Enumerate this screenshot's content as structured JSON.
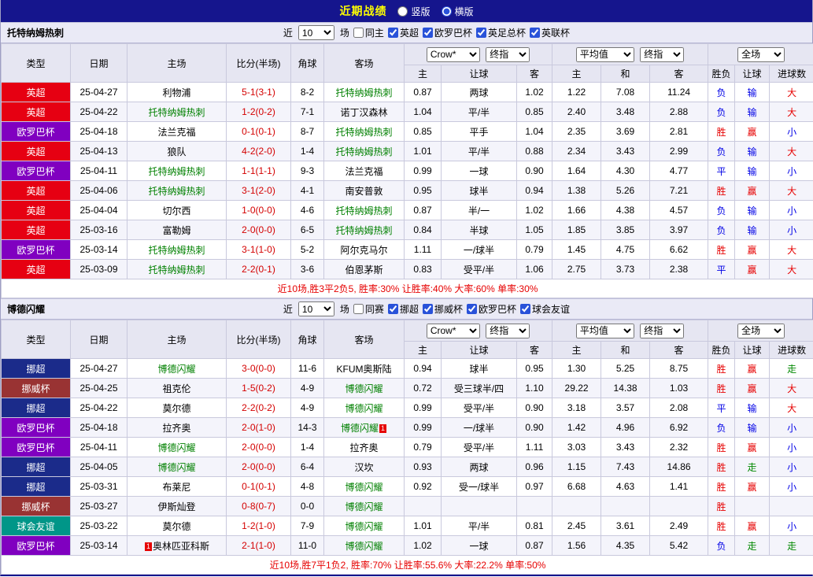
{
  "topbar": {
    "title": "近期战绩",
    "vertical_label": "竖版",
    "horizontal_label": "横版"
  },
  "filter_labels": {
    "near": "近",
    "matches": "场"
  },
  "dropdowns": {
    "near_count": "10",
    "bookmaker": "Crow*",
    "final_odds": "终指",
    "average": "平均值",
    "final_odds2": "终指",
    "full_match": "全场"
  },
  "columns": {
    "type": "类型",
    "date": "日期",
    "home": "主场",
    "score": "比分(半场)",
    "corner": "角球",
    "away": "客场",
    "sub": [
      "主",
      "让球",
      "客",
      "主",
      "和",
      "客",
      "胜负",
      "让球",
      "进球数"
    ]
  },
  "league_colors": {
    "英超": "#e60012",
    "欧罗巴杯": "#8000c0",
    "挪超": "#1b2b8a",
    "挪威杯": "#993333",
    "球会友谊": "#009688"
  },
  "result_colors": {
    "胜": "#e60000",
    "平": "#0000e6",
    "负": "#0000e6",
    "赢": "#e60000",
    "输": "#0000e6",
    "走": "#008800",
    "大": "#e60000",
    "小": "#0000e6"
  },
  "sections": [
    {
      "team": "托特纳姆热刺",
      "same_label": "同主",
      "leagues": [
        "英超",
        "欧罗巴杯",
        "英足总杯",
        "英联杯"
      ],
      "rows": [
        {
          "league": "英超",
          "date": "25-04-27",
          "home": "利物浦",
          "home_focal": false,
          "home_red": "",
          "score": "5-1(3-1)",
          "corners": "8-2",
          "away": "托特纳姆热刺",
          "away_focal": true,
          "away_red": "",
          "home_odds": "0.87",
          "handicap": "两球",
          "away_odds": "1.02",
          "avg_home": "1.22",
          "avg_draw": "7.08",
          "avg_away": "11.24",
          "result": "负",
          "handicap_result": "输",
          "goals_result": "大"
        },
        {
          "league": "英超",
          "date": "25-04-22",
          "home": "托特纳姆热刺",
          "home_focal": true,
          "home_red": "",
          "score": "1-2(0-2)",
          "corners": "7-1",
          "away": "诺丁汉森林",
          "away_focal": false,
          "away_red": "",
          "home_odds": "1.04",
          "handicap": "平/半",
          "away_odds": "0.85",
          "avg_home": "2.40",
          "avg_draw": "3.48",
          "avg_away": "2.88",
          "result": "负",
          "handicap_result": "输",
          "goals_result": "大"
        },
        {
          "league": "欧罗巴杯",
          "date": "25-04-18",
          "home": "法兰克福",
          "home_focal": false,
          "home_red": "",
          "score": "0-1(0-1)",
          "corners": "8-7",
          "away": "托特纳姆热刺",
          "away_focal": true,
          "away_red": "",
          "home_odds": "0.85",
          "handicap": "平手",
          "away_odds": "1.04",
          "avg_home": "2.35",
          "avg_draw": "3.69",
          "avg_away": "2.81",
          "result": "胜",
          "handicap_result": "赢",
          "goals_result": "小"
        },
        {
          "league": "英超",
          "date": "25-04-13",
          "home": "狼队",
          "home_focal": false,
          "home_red": "",
          "score": "4-2(2-0)",
          "corners": "1-4",
          "away": "托特纳姆热刺",
          "away_focal": true,
          "away_red": "",
          "home_odds": "1.01",
          "handicap": "平/半",
          "away_odds": "0.88",
          "avg_home": "2.34",
          "avg_draw": "3.43",
          "avg_away": "2.99",
          "result": "负",
          "handicap_result": "输",
          "goals_result": "大"
        },
        {
          "league": "欧罗巴杯",
          "date": "25-04-11",
          "home": "托特纳姆热刺",
          "home_focal": true,
          "home_red": "",
          "score": "1-1(1-1)",
          "corners": "9-3",
          "away": "法兰克福",
          "away_focal": false,
          "away_red": "",
          "home_odds": "0.99",
          "handicap": "一球",
          "away_odds": "0.90",
          "avg_home": "1.64",
          "avg_draw": "4.30",
          "avg_away": "4.77",
          "result": "平",
          "handicap_result": "输",
          "goals_result": "小"
        },
        {
          "league": "英超",
          "date": "25-04-06",
          "home": "托特纳姆热刺",
          "home_focal": true,
          "home_red": "",
          "score": "3-1(2-0)",
          "corners": "4-1",
          "away": "南安普敦",
          "away_focal": false,
          "away_red": "",
          "home_odds": "0.95",
          "handicap": "球半",
          "away_odds": "0.94",
          "avg_home": "1.38",
          "avg_draw": "5.26",
          "avg_away": "7.21",
          "result": "胜",
          "handicap_result": "赢",
          "goals_result": "大"
        },
        {
          "league": "英超",
          "date": "25-04-04",
          "home": "切尔西",
          "home_focal": false,
          "home_red": "",
          "score": "1-0(0-0)",
          "corners": "4-6",
          "away": "托特纳姆热刺",
          "away_focal": true,
          "away_red": "",
          "home_odds": "0.87",
          "handicap": "半/一",
          "away_odds": "1.02",
          "avg_home": "1.66",
          "avg_draw": "4.38",
          "avg_away": "4.57",
          "result": "负",
          "handicap_result": "输",
          "goals_result": "小"
        },
        {
          "league": "英超",
          "date": "25-03-16",
          "home": "富勒姆",
          "home_focal": false,
          "home_red": "",
          "score": "2-0(0-0)",
          "corners": "6-5",
          "away": "托特纳姆热刺",
          "away_focal": true,
          "away_red": "",
          "home_odds": "0.84",
          "handicap": "半球",
          "away_odds": "1.05",
          "avg_home": "1.85",
          "avg_draw": "3.85",
          "avg_away": "3.97",
          "result": "负",
          "handicap_result": "输",
          "goals_result": "小"
        },
        {
          "league": "欧罗巴杯",
          "date": "25-03-14",
          "home": "托特纳姆热刺",
          "home_focal": true,
          "home_red": "",
          "score": "3-1(1-0)",
          "corners": "5-2",
          "away": "阿尔克马尔",
          "away_focal": false,
          "away_red": "",
          "home_odds": "1.11",
          "handicap": "一/球半",
          "away_odds": "0.79",
          "avg_home": "1.45",
          "avg_draw": "4.75",
          "avg_away": "6.62",
          "result": "胜",
          "handicap_result": "赢",
          "goals_result": "大"
        },
        {
          "league": "英超",
          "date": "25-03-09",
          "home": "托特纳姆热刺",
          "home_focal": true,
          "home_red": "",
          "score": "2-2(0-1)",
          "corners": "3-6",
          "away": "伯恩茅斯",
          "away_focal": false,
          "away_red": "",
          "home_odds": "0.83",
          "handicap": "受平/半",
          "away_odds": "1.06",
          "avg_home": "2.75",
          "avg_draw": "3.73",
          "avg_away": "2.38",
          "result": "平",
          "handicap_result": "赢",
          "goals_result": "大"
        }
      ],
      "summary": "近10场,胜3平2负5, 胜率:30% 让胜率:40% 大率:60% 单率:30%"
    },
    {
      "team": "博德闪耀",
      "same_label": "同赛",
      "leagues": [
        "挪超",
        "挪威杯",
        "欧罗巴杯",
        "球会友谊"
      ],
      "rows": [
        {
          "league": "挪超",
          "date": "25-04-27",
          "home": "博德闪耀",
          "home_focal": true,
          "home_red": "",
          "score": "3-0(0-0)",
          "corners": "11-6",
          "away": "KFUM奥斯陆",
          "away_focal": false,
          "away_red": "",
          "home_odds": "0.94",
          "handicap": "球半",
          "away_odds": "0.95",
          "avg_home": "1.30",
          "avg_draw": "5.25",
          "avg_away": "8.75",
          "result": "胜",
          "handicap_result": "赢",
          "goals_result": "走"
        },
        {
          "league": "挪威杯",
          "date": "25-04-25",
          "home": "祖克伦",
          "home_focal": false,
          "home_red": "",
          "score": "1-5(0-2)",
          "corners": "4-9",
          "away": "博德闪耀",
          "away_focal": true,
          "away_red": "",
          "home_odds": "0.72",
          "handicap": "受三球半/四",
          "away_odds": "1.10",
          "avg_home": "29.22",
          "avg_draw": "14.38",
          "avg_away": "1.03",
          "result": "胜",
          "handicap_result": "赢",
          "goals_result": "大"
        },
        {
          "league": "挪超",
          "date": "25-04-22",
          "home": "莫尔德",
          "home_focal": false,
          "home_red": "",
          "score": "2-2(0-2)",
          "corners": "4-9",
          "away": "博德闪耀",
          "away_focal": true,
          "away_red": "",
          "home_odds": "0.99",
          "handicap": "受平/半",
          "away_odds": "0.90",
          "avg_home": "3.18",
          "avg_draw": "3.57",
          "avg_away": "2.08",
          "result": "平",
          "handicap_result": "输",
          "goals_result": "大"
        },
        {
          "league": "欧罗巴杯",
          "date": "25-04-18",
          "home": "拉齐奥",
          "home_focal": false,
          "home_red": "",
          "score": "2-0(1-0)",
          "corners": "14-3",
          "away": "博德闪耀",
          "away_focal": true,
          "away_red": "1",
          "home_odds": "0.99",
          "handicap": "一/球半",
          "away_odds": "0.90",
          "avg_home": "1.42",
          "avg_draw": "4.96",
          "avg_away": "6.92",
          "result": "负",
          "handicap_result": "输",
          "goals_result": "小"
        },
        {
          "league": "欧罗巴杯",
          "date": "25-04-11",
          "home": "博德闪耀",
          "home_focal": true,
          "home_red": "",
          "score": "2-0(0-0)",
          "corners": "1-4",
          "away": "拉齐奥",
          "away_focal": false,
          "away_red": "",
          "home_odds": "0.79",
          "handicap": "受平/半",
          "away_odds": "1.11",
          "avg_home": "3.03",
          "avg_draw": "3.43",
          "avg_away": "2.32",
          "result": "胜",
          "handicap_result": "赢",
          "goals_result": "小"
        },
        {
          "league": "挪超",
          "date": "25-04-05",
          "home": "博德闪耀",
          "home_focal": true,
          "home_red": "",
          "score": "2-0(0-0)",
          "corners": "6-4",
          "away": "汉坎",
          "away_focal": false,
          "away_red": "",
          "home_odds": "0.93",
          "handicap": "两球",
          "away_odds": "0.96",
          "avg_home": "1.15",
          "avg_draw": "7.43",
          "avg_away": "14.86",
          "result": "胜",
          "handicap_result": "走",
          "goals_result": "小"
        },
        {
          "league": "挪超",
          "date": "25-03-31",
          "home": "布莱尼",
          "home_focal": false,
          "home_red": "",
          "score": "0-1(0-1)",
          "corners": "4-8",
          "away": "博德闪耀",
          "away_focal": true,
          "away_red": "",
          "home_odds": "0.92",
          "handicap": "受一/球半",
          "away_odds": "0.97",
          "avg_home": "6.68",
          "avg_draw": "4.63",
          "avg_away": "1.41",
          "result": "胜",
          "handicap_result": "赢",
          "goals_result": "小"
        },
        {
          "league": "挪威杯",
          "date": "25-03-27",
          "home": "伊斯灿登",
          "home_focal": false,
          "home_red": "",
          "score": "0-8(0-7)",
          "corners": "0-0",
          "away": "博德闪耀",
          "away_focal": true,
          "away_red": "",
          "home_odds": "",
          "handicap": "",
          "away_odds": "",
          "avg_home": "",
          "avg_draw": "",
          "avg_away": "",
          "result": "胜",
          "handicap_result": "",
          "goals_result": ""
        },
        {
          "league": "球会友谊",
          "date": "25-03-22",
          "home": "莫尔德",
          "home_focal": false,
          "home_red": "",
          "score": "1-2(1-0)",
          "corners": "7-9",
          "away": "博德闪耀",
          "away_focal": true,
          "away_red": "",
          "home_odds": "1.01",
          "handicap": "平/半",
          "away_odds": "0.81",
          "avg_home": "2.45",
          "avg_draw": "3.61",
          "avg_away": "2.49",
          "result": "胜",
          "handicap_result": "赢",
          "goals_result": "小"
        },
        {
          "league": "欧罗巴杯",
          "date": "25-03-14",
          "home": "奥林匹亚科斯",
          "home_focal": false,
          "home_red": "1",
          "score": "2-1(1-0)",
          "corners": "11-0",
          "away": "博德闪耀",
          "away_focal": true,
          "away_red": "",
          "home_odds": "1.02",
          "handicap": "一球",
          "away_odds": "0.87",
          "avg_home": "1.56",
          "avg_draw": "4.35",
          "avg_away": "5.42",
          "result": "负",
          "handicap_result": "走",
          "goals_result": "走"
        }
      ],
      "summary": "近10场,胜7平1负2, 胜率:70% 让胜率:55.6% 大率:22.2% 单率:50%"
    }
  ]
}
